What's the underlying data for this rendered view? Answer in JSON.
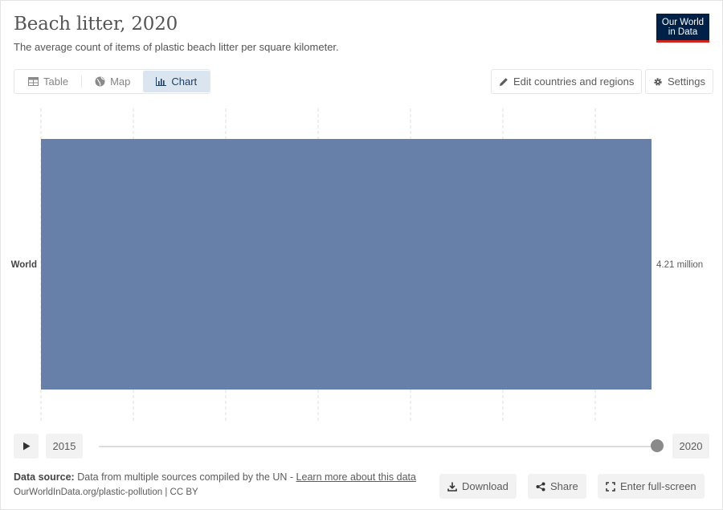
{
  "header": {
    "title": "Beach litter, 2020",
    "subtitle": "The average count of items of plastic beach litter per square kilometer.",
    "logo_line1": "Our World",
    "logo_line2": "in Data"
  },
  "tabs": [
    {
      "label": "Table",
      "icon": "table-icon"
    },
    {
      "label": "Map",
      "icon": "globe-icon"
    },
    {
      "label": "Chart",
      "icon": "chart-icon",
      "active": true
    }
  ],
  "toolbar": {
    "edit_label": "Edit countries and regions",
    "settings_label": "Settings"
  },
  "chart_data": {
    "type": "bar",
    "orientation": "horizontal",
    "categories": [
      "World"
    ],
    "values": [
      4210000
    ],
    "value_labels": [
      "4.21 million"
    ],
    "colors": [
      "#6680a9"
    ],
    "xlim": [
      0,
      4210000
    ],
    "grid": true
  },
  "timeline": {
    "start_year": "2015",
    "end_year": "2020",
    "selected_fraction": 1.0
  },
  "footer": {
    "source_label": "Data source:",
    "source_text": "Data from multiple sources compiled by the UN - ",
    "source_link": "Learn more about this data",
    "url_text": "OurWorldInData.org/plastic-pollution | CC BY",
    "download_label": "Download",
    "share_label": "Share",
    "fullscreen_label": "Enter full-screen"
  }
}
